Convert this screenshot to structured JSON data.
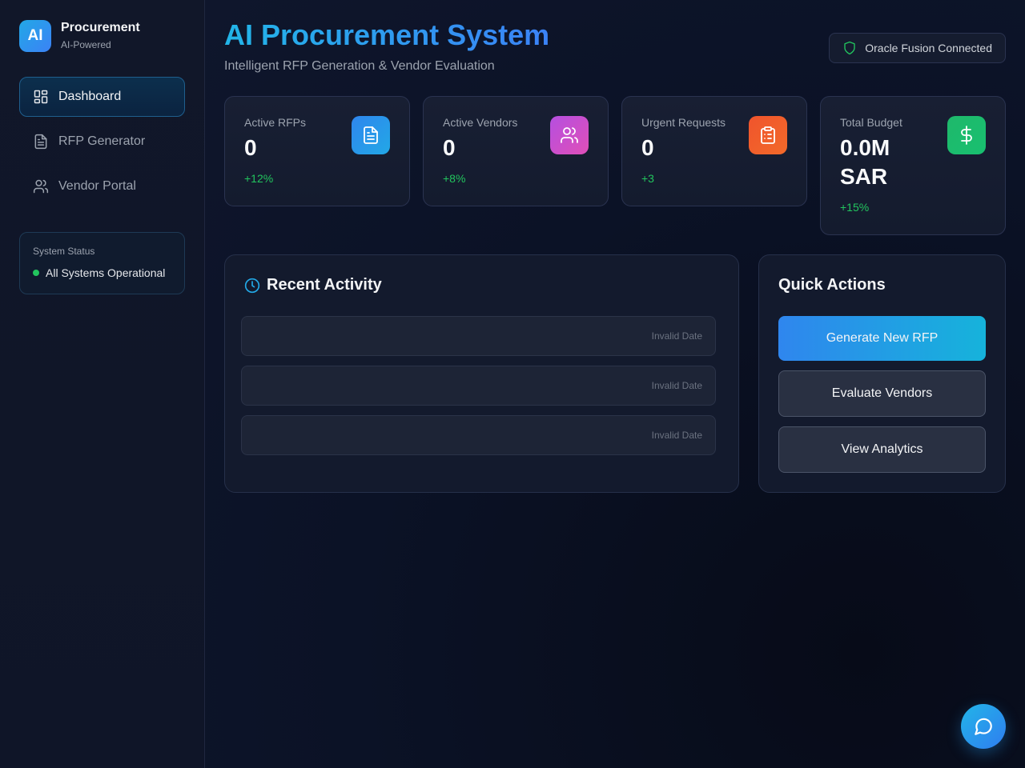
{
  "brand": {
    "logo_text": "AI",
    "name": "Procurement",
    "subtitle": "AI-Powered"
  },
  "sidebar": {
    "items": [
      {
        "label": "Dashboard",
        "icon": "dashboard-icon",
        "active": true
      },
      {
        "label": "RFP Generator",
        "icon": "document-icon",
        "active": false
      },
      {
        "label": "Vendor Portal",
        "icon": "users-icon",
        "active": false
      }
    ],
    "status": {
      "title": "System Status",
      "text": "All Systems Operational",
      "color": "#22c55e"
    }
  },
  "header": {
    "title": "AI Procurement System",
    "subtitle": "Intelligent RFP Generation & Vendor Evaluation",
    "badge": "Oracle Fusion Connected"
  },
  "stats": [
    {
      "label": "Active RFPs",
      "value": "0",
      "change": "+12%",
      "icon": "document-icon",
      "color": "#2f86ee"
    },
    {
      "label": "Active Vendors",
      "value": "0",
      "change": "+8%",
      "icon": "users-icon",
      "color": "#c04fd8"
    },
    {
      "label": "Urgent Requests",
      "value": "0",
      "change": "+3",
      "icon": "clipboard-icon",
      "color": "#f0542c"
    },
    {
      "label": "Total Budget",
      "value": "0.0M SAR",
      "change": "+15%",
      "icon": "dollar-icon",
      "color": "#1fb86b"
    }
  ],
  "activity": {
    "title": "Recent Activity",
    "items": [
      {
        "date": "Invalid Date"
      },
      {
        "date": "Invalid Date"
      },
      {
        "date": "Invalid Date"
      }
    ]
  },
  "quick_actions": {
    "title": "Quick Actions",
    "buttons": [
      "Generate New RFP",
      "Evaluate Vendors",
      "View Analytics"
    ]
  },
  "chat": {
    "icon": "chat-icon"
  }
}
